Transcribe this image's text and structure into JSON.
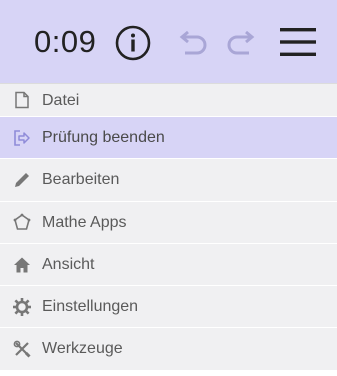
{
  "header": {
    "timer": "0:09",
    "icons": {
      "info": "info-icon",
      "undo": "undo-icon",
      "redo": "redo-icon",
      "menu": "hamburger-menu-icon"
    }
  },
  "menu": {
    "items": [
      {
        "label": "Datei",
        "icon": "file-icon",
        "active": false
      },
      {
        "label": "Prüfung beenden",
        "icon": "exit-icon",
        "active": true
      },
      {
        "label": "Bearbeiten",
        "icon": "pencil-icon",
        "active": false
      },
      {
        "label": "Mathe Apps",
        "icon": "apps-icon",
        "active": false
      },
      {
        "label": "Ansicht",
        "icon": "view-icon",
        "active": false
      },
      {
        "label": "Einstellungen",
        "icon": "gear-icon",
        "active": false
      },
      {
        "label": "Werkzeuge",
        "icon": "tools-icon",
        "active": false
      }
    ]
  },
  "colors": {
    "header_bg": "#d7d4f6",
    "item_bg": "#f0f0f2",
    "active_bg": "#d7d4f6",
    "icon_gray": "#777777",
    "icon_disabled": "#a9a6d6"
  }
}
